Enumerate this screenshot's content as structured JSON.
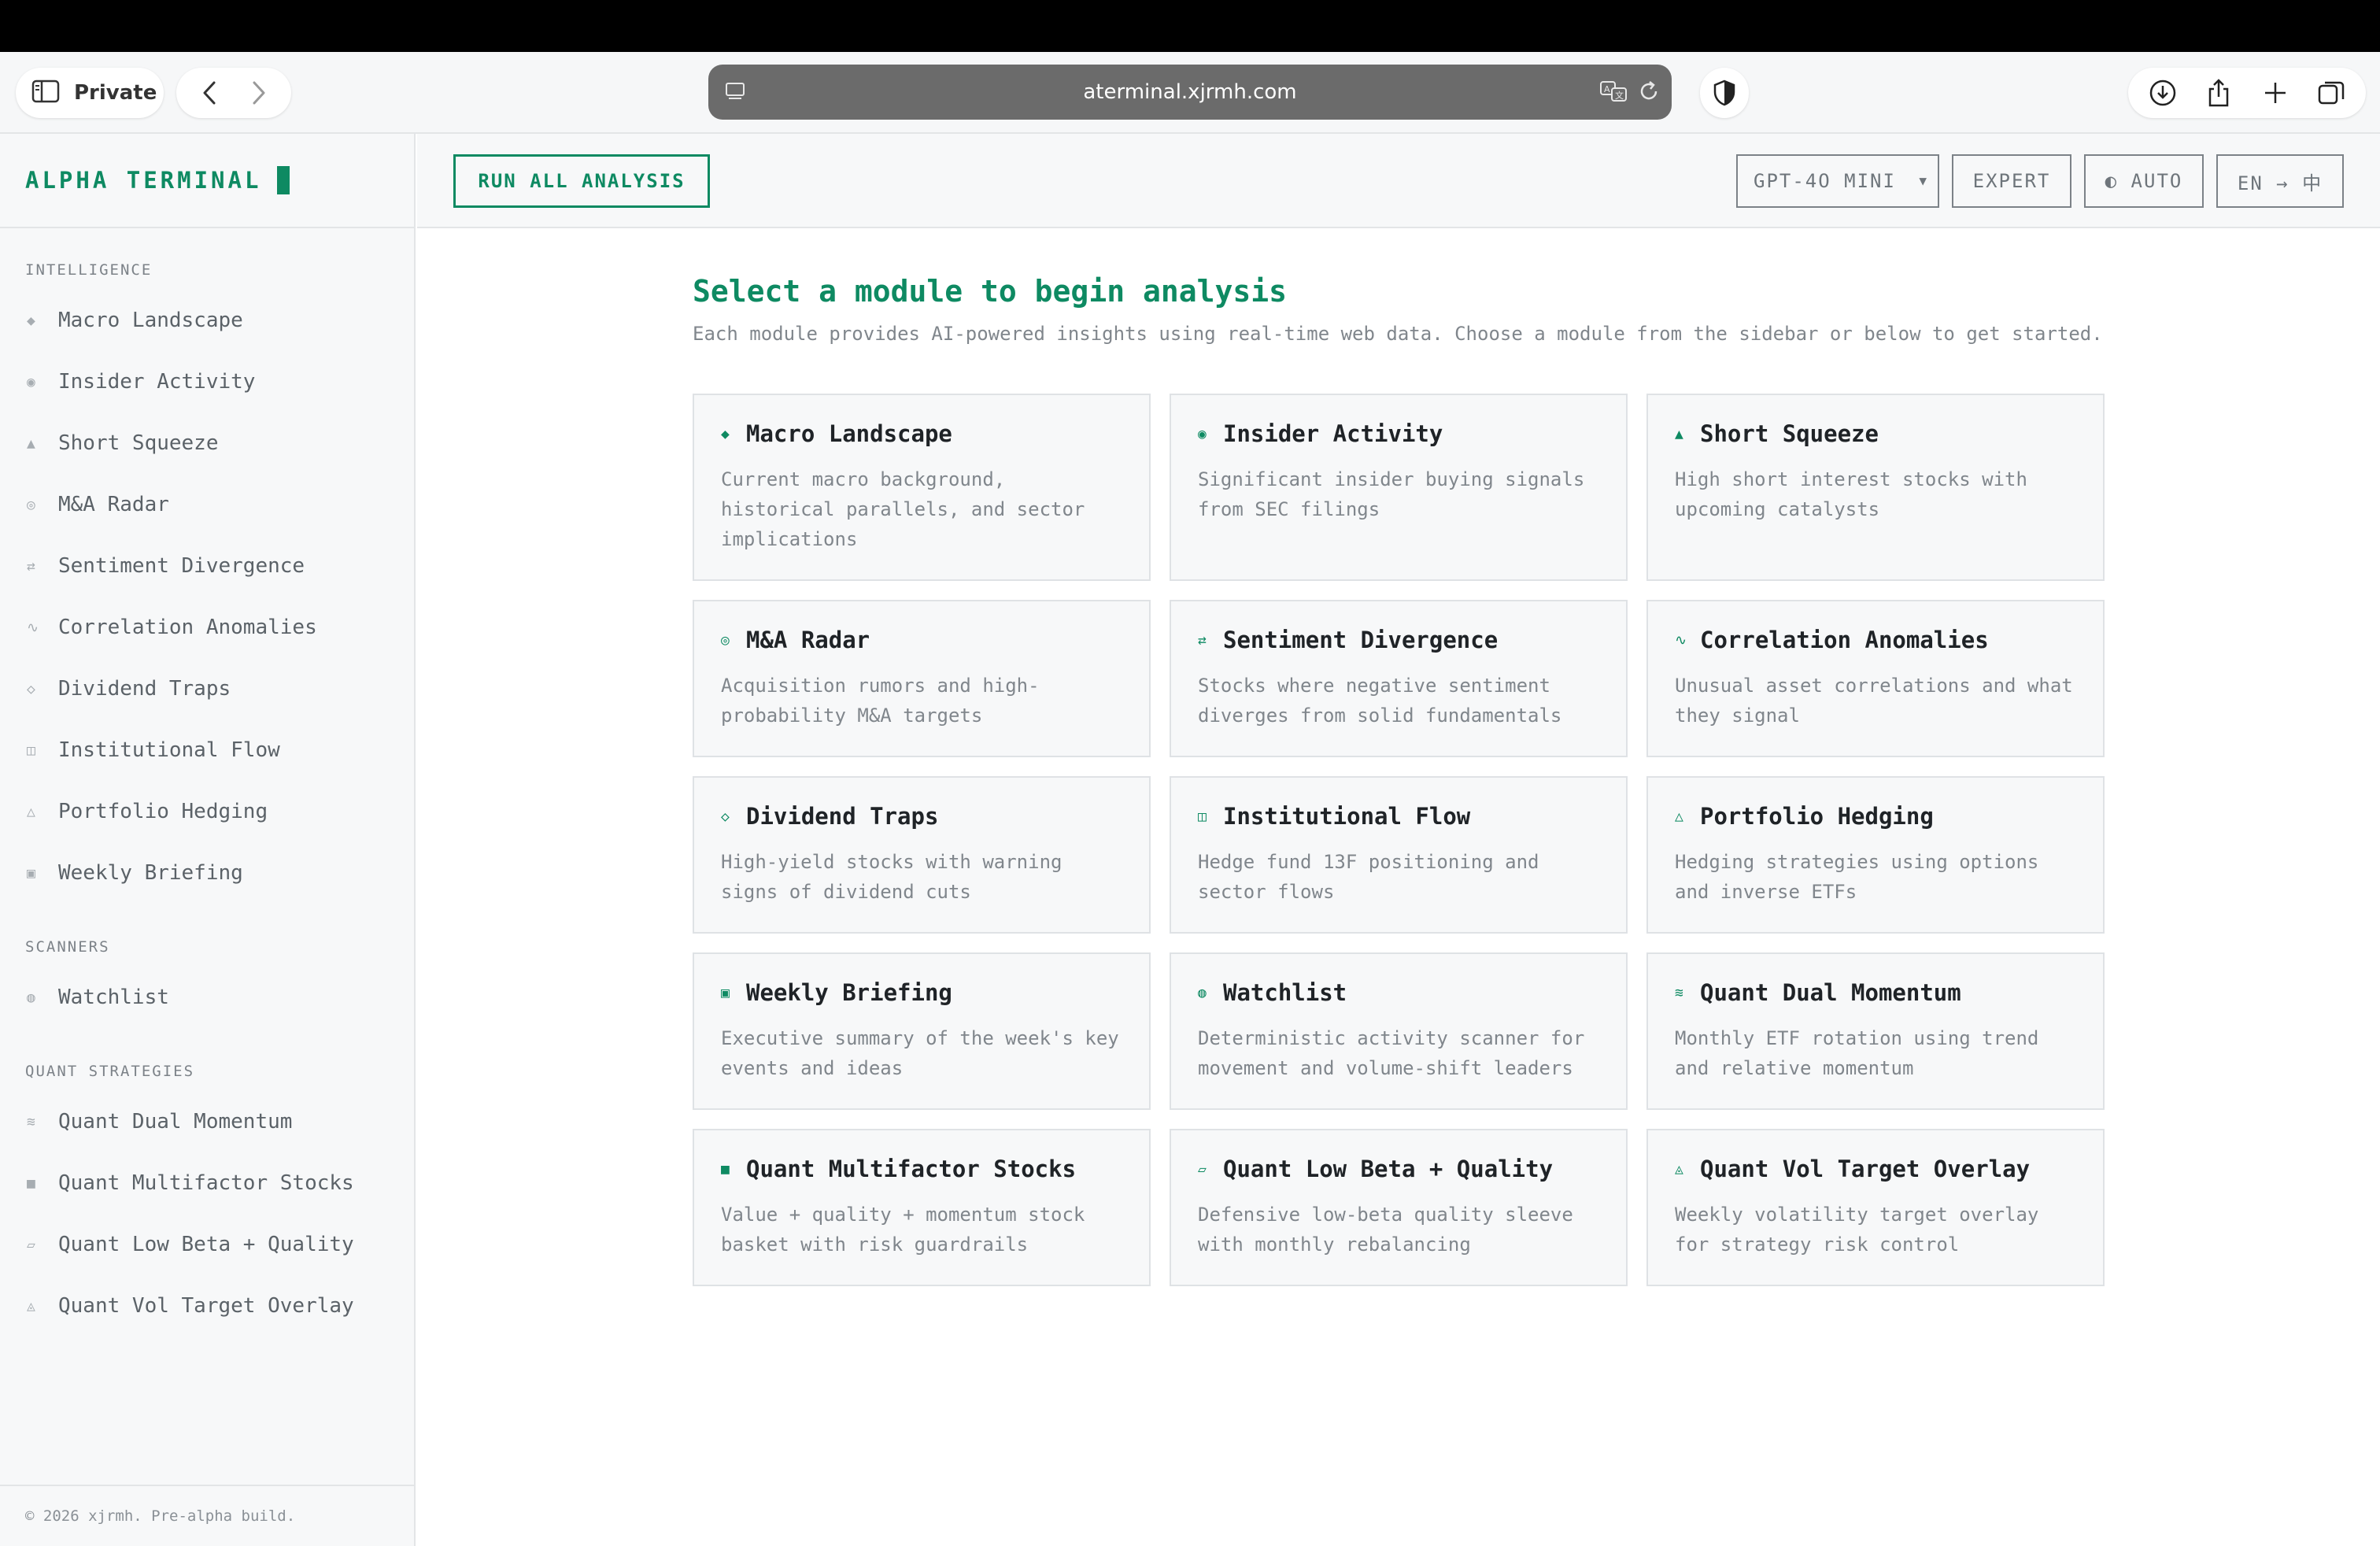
{
  "browser": {
    "private_label": "Private",
    "url": "aterminal.xjrmh.com"
  },
  "brand": {
    "name": "ALPHA TERMINAL"
  },
  "sidebar": {
    "sections": [
      {
        "title": "INTELLIGENCE",
        "items": [
          {
            "icon": "◆",
            "label": "Macro Landscape"
          },
          {
            "icon": "◉",
            "label": "Insider Activity"
          },
          {
            "icon": "▲",
            "label": "Short Squeeze"
          },
          {
            "icon": "◎",
            "label": "M&A Radar"
          },
          {
            "icon": "⇄",
            "label": "Sentiment Divergence"
          },
          {
            "icon": "∿",
            "label": "Correlation Anomalies"
          },
          {
            "icon": "◇",
            "label": "Dividend Traps"
          },
          {
            "icon": "◫",
            "label": "Institutional Flow"
          },
          {
            "icon": "△",
            "label": "Portfolio Hedging"
          },
          {
            "icon": "▣",
            "label": "Weekly Briefing"
          }
        ]
      },
      {
        "title": "SCANNERS",
        "items": [
          {
            "icon": "◍",
            "label": "Watchlist"
          }
        ]
      },
      {
        "title": "QUANT STRATEGIES",
        "items": [
          {
            "icon": "≋",
            "label": "Quant Dual Momentum"
          },
          {
            "icon": "■",
            "label": "Quant Multifactor Stocks"
          },
          {
            "icon": "▱",
            "label": "Quant Low Beta + Quality"
          },
          {
            "icon": "◬",
            "label": "Quant Vol Target Overlay"
          }
        ]
      }
    ],
    "footer": "© 2026 xjrmh. Pre-alpha build."
  },
  "toolbar": {
    "run_all": "RUN ALL ANALYSIS",
    "model": "GPT-4O MINI",
    "mode": "EXPERT",
    "theme": "◐ AUTO",
    "language": "EN → 中"
  },
  "main": {
    "heading": "Select a module to begin analysis",
    "subtext": "Each module provides AI-powered insights using real-time web data. Choose a module from the sidebar or below to get started.",
    "cards": [
      {
        "icon": "◆",
        "title": "Macro Landscape",
        "desc": "Current macro background, historical parallels, and sector implications"
      },
      {
        "icon": "◉",
        "title": "Insider Activity",
        "desc": "Significant insider buying signals from SEC filings"
      },
      {
        "icon": "▲",
        "title": "Short Squeeze",
        "desc": "High short interest stocks with upcoming catalysts"
      },
      {
        "icon": "◎",
        "title": "M&A Radar",
        "desc": "Acquisition rumors and high-probability M&A targets"
      },
      {
        "icon": "⇄",
        "title": "Sentiment Divergence",
        "desc": "Stocks where negative sentiment diverges from solid fundamentals"
      },
      {
        "icon": "∿",
        "title": "Correlation Anomalies",
        "desc": "Unusual asset correlations and what they signal"
      },
      {
        "icon": "◇",
        "title": "Dividend Traps",
        "desc": "High-yield stocks with warning signs of dividend cuts"
      },
      {
        "icon": "◫",
        "title": "Institutional Flow",
        "desc": "Hedge fund 13F positioning and sector flows"
      },
      {
        "icon": "△",
        "title": "Portfolio Hedging",
        "desc": "Hedging strategies using options and inverse ETFs"
      },
      {
        "icon": "▣",
        "title": "Weekly Briefing",
        "desc": "Executive summary of the week's key events and ideas"
      },
      {
        "icon": "◍",
        "title": "Watchlist",
        "desc": "Deterministic activity scanner for movement and volume-shift leaders"
      },
      {
        "icon": "≋",
        "title": "Quant Dual Momentum",
        "desc": "Monthly ETF rotation using trend and relative momentum"
      },
      {
        "icon": "■",
        "title": "Quant Multifactor Stocks",
        "desc": "Value + quality + momentum stock basket with risk guardrails"
      },
      {
        "icon": "▱",
        "title": "Quant Low Beta + Quality",
        "desc": "Defensive low-beta quality sleeve with monthly rebalancing"
      },
      {
        "icon": "◬",
        "title": "Quant Vol Target Overlay",
        "desc": "Weekly volatility target overlay for strategy risk control"
      }
    ]
  },
  "colors": {
    "accent": "#0e8a62",
    "sidebar_bg": "#f7f8f9",
    "text_muted": "#80868c"
  }
}
